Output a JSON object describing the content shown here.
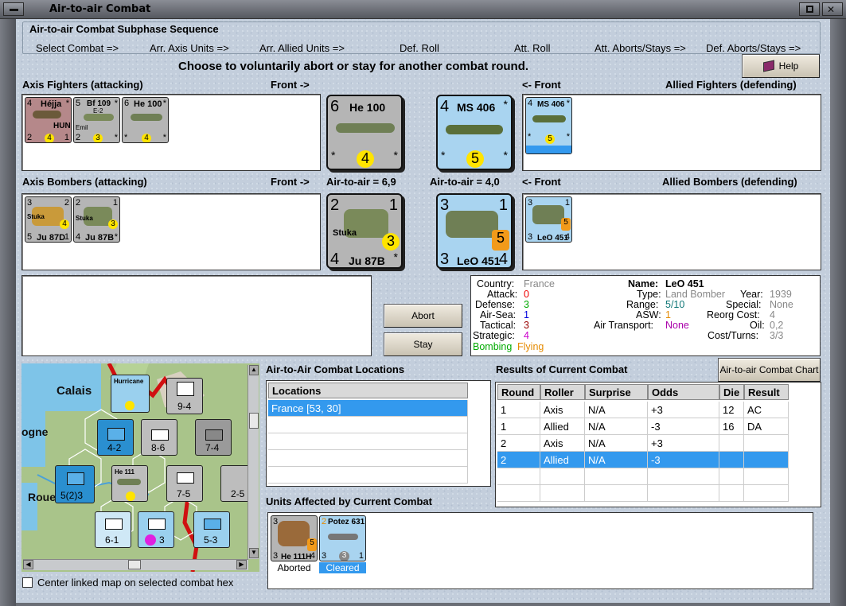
{
  "window": {
    "title": "Air-to-air Combat"
  },
  "sequence": {
    "title": "Air-to-air Combat Subphase Sequence",
    "steps": [
      "Select Combat =>",
      "Arr. Axis Units =>",
      "Arr. Allied Units =>",
      "Def. Roll",
      "Att. Roll",
      "Att. Aborts/Stays =>",
      "Def. Aborts/Stays =>"
    ]
  },
  "instruction": "Choose to voluntarily abort or stay for another combat round.",
  "help_button": "Help",
  "sections": {
    "axis_fighters": "Axis Fighters (attacking)",
    "front_right": "Front ->",
    "front_left": "<- Front",
    "allied_fighters": "Allied Fighters (defending)",
    "axis_bombers": "Axis Bombers (attacking)",
    "air_to_air_axis": "Air-to-air = 6,9",
    "air_to_air_allied": "Air-to-air = 4,0",
    "allied_bombers": "Allied Bombers (defending)"
  },
  "axis_fighters": [
    {
      "name": "Héjja",
      "tl": "4",
      "tr": "*",
      "bl": "2",
      "br": "1",
      "dot": "4",
      "extra": "HUN"
    },
    {
      "name": "Bf 109",
      "tl": "5",
      "tr": "*",
      "bl": "2",
      "br": "*",
      "dot": "3",
      "extra": "E-2",
      "extra2": "Emil"
    },
    {
      "name": "He 100",
      "tl": "6",
      "tr": "*",
      "bl": "*",
      "br": "*",
      "dot": "4"
    }
  ],
  "axis_front_fighter": {
    "name": "He 100",
    "tl": "6",
    "bl": "*",
    "br": "*",
    "dot": "4"
  },
  "allied_front_fighter": {
    "name": "MS 406",
    "tl": "4",
    "tr": "*",
    "bl": "*",
    "br": "*",
    "dot": "5"
  },
  "allied_fighters": [
    {
      "name": "MS 406",
      "tl": "4",
      "tr": "*",
      "bl": "*",
      "br": "*",
      "dot": "5"
    }
  ],
  "axis_bombers": [
    {
      "name": "Ju 87D",
      "tl": "3",
      "tr": "2",
      "bl": "5",
      "br": "1",
      "dot": "4",
      "extra": "Stuka"
    },
    {
      "name": "Ju 87B",
      "tl": "2",
      "tr": "1",
      "bl": "4",
      "br": "*",
      "dot": "3",
      "extra": "Stuka"
    }
  ],
  "axis_front_bomber": {
    "name": "Ju 87B",
    "tl": "2",
    "tr": "1",
    "bl": "4",
    "br": "*",
    "dot": "3",
    "extra": "Stuka"
  },
  "allied_front_bomber": {
    "name": "LeO 451",
    "tl": "3",
    "tr": "1",
    "bl": "3",
    "br": "4",
    "dot": "5"
  },
  "allied_bombers": [
    {
      "name": "LeO 451",
      "tl": "3",
      "tr": "1",
      "bl": "3",
      "br": "4",
      "dot": "5"
    }
  ],
  "abort_button": "Abort",
  "stay_button": "Stay",
  "unit_info": {
    "country_label": "Country:",
    "country": "France",
    "attack_label": "Attack:",
    "attack": "0",
    "defense_label": "Defense:",
    "defense": "3",
    "airsea_label": "Air-Sea:",
    "airsea": "1",
    "tactical_label": "Tactical:",
    "tactical": "3",
    "strategic_label": "Strategic:",
    "strategic": "4",
    "bombing": "Bombing",
    "flying": "Flying",
    "name_label": "Name:",
    "name": "LeO 451",
    "type_label": "Type:",
    "type": "Land Bomber",
    "year_label": "Year:",
    "year": "1939",
    "range_label": "Range:",
    "range": "5/10",
    "special_label": "Special:",
    "special": "None",
    "asw_label": "ASW:",
    "asw": "1",
    "reorg_label": "Reorg Cost:",
    "reorg": "4",
    "airtransport_label": "Air Transport:",
    "airtransport": "None",
    "oil_label": "Oil:",
    "oil": "0,2",
    "cost_label": "Cost/Turns:",
    "cost": "3/3"
  },
  "map": {
    "labels": [
      "Calais",
      "ogne",
      "Rouen"
    ],
    "counters": [
      "Hurricane",
      "9-4",
      "4-2",
      "8-6",
      "7-4",
      "5(2)3",
      "He 111",
      "7-5",
      "2-5",
      "6-1",
      "3",
      "5-3"
    ]
  },
  "locations": {
    "title": "Air-to-Air Combat Locations",
    "header": "Locations",
    "items": [
      "France [53, 30]"
    ]
  },
  "results": {
    "title": "Results of Current Combat",
    "chart_button": "Air-to-air Combat Chart",
    "headers": [
      "Round",
      "Roller",
      "Surprise",
      "Odds",
      "Die",
      "Result"
    ],
    "rows": [
      [
        "1",
        "Axis",
        "N/A",
        "+3",
        "12",
        "AC"
      ],
      [
        "1",
        "Allied",
        "N/A",
        "-3",
        "16",
        "DA"
      ],
      [
        "2",
        "Axis",
        "N/A",
        "+3",
        "",
        ""
      ],
      [
        "2",
        "Allied",
        "N/A",
        "-3",
        "",
        ""
      ]
    ]
  },
  "affected": {
    "title": "Units Affected by Current Combat",
    "units": [
      {
        "name": "He 111H",
        "tl": "3",
        "bl": "3",
        "br": "4",
        "dot": "5",
        "status": "Aborted"
      },
      {
        "name": "Potez 631",
        "tl": "2",
        "bl": "3",
        "br": "1",
        "dot": "3",
        "status": "Cleared"
      }
    ]
  },
  "center_checkbox": "Center linked map on selected combat hex",
  "colors": {
    "axis_counter": "#b5b5b5",
    "allied_counter": "#a9d4f0",
    "hun_counter": "#b5888a",
    "selection": "#3399ee"
  }
}
